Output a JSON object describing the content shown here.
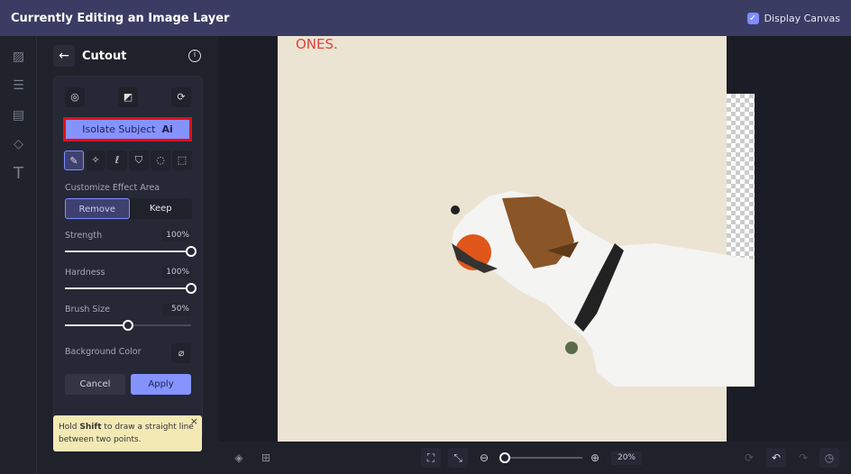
{
  "header": {
    "title": "Currently Editing an Image Layer",
    "display_canvas_label": "Display Canvas",
    "display_canvas_checked": true
  },
  "rail": {
    "items": [
      "image-icon",
      "sliders-icon",
      "layout-icon",
      "shapes-icon",
      "text-icon"
    ]
  },
  "panel": {
    "title": "Cutout",
    "isolate_label": "Isolate Subject",
    "ai_badge": "Ai",
    "customize_label": "Customize Effect Area",
    "remove_label": "Remove",
    "keep_label": "Keep",
    "strength": {
      "label": "Strength",
      "value_text": "100%",
      "value": 100
    },
    "hardness": {
      "label": "Hardness",
      "value_text": "100%",
      "value": 100
    },
    "brush": {
      "label": "Brush Size",
      "value_text": "50%",
      "value": 50
    },
    "bg_color_label": "Background Color",
    "cancel_label": "Cancel",
    "apply_label": "Apply",
    "tip_pre": "Hold ",
    "tip_bold": "Shift",
    "tip_post": " to draw a straight line between two points."
  },
  "canvas": {
    "text": "ONES."
  },
  "bottom": {
    "zoom": "20%",
    "zoom_value": 20
  },
  "colors": {
    "accent": "#7f8cff",
    "header": "#3b3c63",
    "highlight": "#e0101a"
  }
}
